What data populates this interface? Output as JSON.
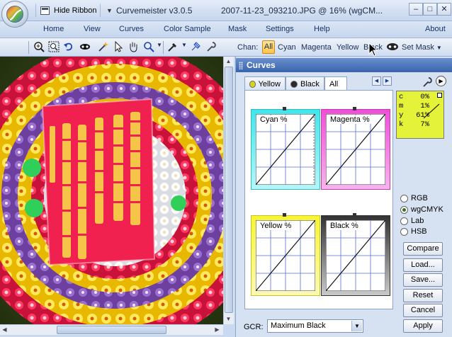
{
  "titlebar": {
    "ribbon_button": "Hide Ribbon",
    "app_title": "Curvemeister v3.0.5",
    "file_title": "2007-11-23_093210.JPG @ 16% (wgCM...",
    "min": "–",
    "max": "□",
    "close": "✕"
  },
  "menus": [
    "Home",
    "View",
    "Curves",
    "Color Sample",
    "Mask",
    "Settings",
    "Help",
    "About"
  ],
  "toolbar": {
    "chan_label": "Chan:",
    "channels": [
      "All",
      "Cyan",
      "Magenta",
      "Yellow",
      "Black"
    ],
    "set_mask": "Set Mask"
  },
  "panel": {
    "title": "Curves",
    "tabs": [
      {
        "label": "Yellow",
        "icon": "yellow-dot-icon",
        "color": "#d8d41c"
      },
      {
        "label": "Black",
        "icon": "black-dot-icon",
        "color": "#2b2b2b"
      },
      {
        "label": "All"
      }
    ],
    "curves": [
      {
        "label": "Cyan %"
      },
      {
        "label": "Magenta %"
      },
      {
        "label": "Yellow %"
      },
      {
        "label": "Black %"
      }
    ],
    "readout": {
      "labels": [
        "c",
        "m",
        "y",
        "k"
      ],
      "values": [
        "0%",
        "1%",
        "61%",
        "7%"
      ]
    },
    "color_modes": [
      "RGB",
      "wgCMYK",
      "Lab",
      "HSB"
    ],
    "selected_mode": "wgCMYK",
    "buttons": [
      "Compare",
      "Load...",
      "Save...",
      "Reset",
      "Cancel",
      "Apply"
    ],
    "gcr_label": "GCR:",
    "gcr_value": "Maximum Black"
  },
  "colors": {
    "accent_highlight": "#ffc445",
    "panel_header": "#3a63ab",
    "cyan": "#3fe6ec",
    "magenta": "#f04ed8",
    "yellow": "#f8f52f",
    "black": "#333333"
  }
}
